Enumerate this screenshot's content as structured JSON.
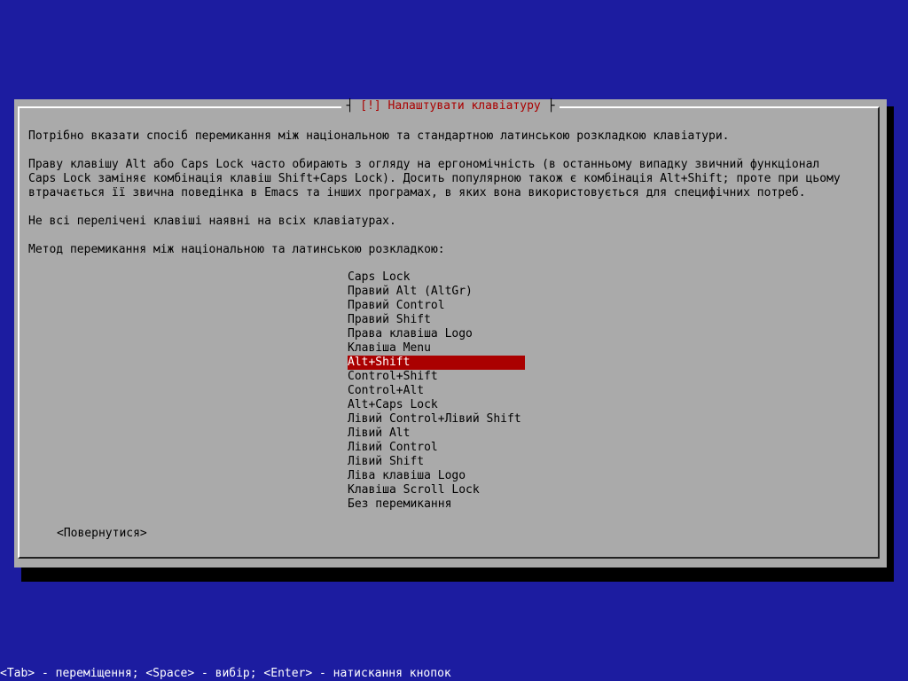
{
  "dialog": {
    "title_bracket_left": "┤ ",
    "title": "[!] Налаштувати клавіатуру",
    "title_bracket_right": " ├",
    "paragraphs": [
      "Потрібно вказати спосіб перемикання між національною та стандартною латинською розкладкою клавіатури.",
      "Праву клавішу Alt або Caps Lock часто обирають з огляду на ергономічність (в останньому випадку звичний функціонал",
      "Caps Lock заміняє комбінація клавіш Shift+Caps Lock). Досить популярною також є комбінація Alt+Shift; проте при цьому",
      "втрачається її звична поведінка в Emacs та інших програмах, в яких вона використовується для специфічних потреб.",
      "Не всі перелічені клавіші наявні на всіх клавіатурах.",
      "Метод перемикання між національною та латинською розкладкою:"
    ],
    "options": [
      "Caps Lock",
      "Правий Alt (AltGr)",
      "Правий Control",
      "Правий Shift",
      "Права клавіша Logo",
      "Клавіша Menu",
      "Alt+Shift",
      "Control+Shift",
      "Control+Alt",
      "Alt+Caps Lock",
      "Лівий Control+Лівий Shift",
      "Лівий Alt",
      "Лівий Control",
      "Лівий Shift",
      "Ліва клавіша Logo",
      "Клавіша Scroll Lock",
      "Без перемикання"
    ],
    "selected_option": "Alt+Shift",
    "back_button": "<Повернутися>"
  },
  "footer": {
    "help": "<Tab> - переміщення; <Space> - вибір; <Enter> - натискання кнопок"
  },
  "colors": {
    "background": "#1c1ca0",
    "dialog": "#aaaaaa",
    "highlight": "#aa0000",
    "title": "#aa0000"
  }
}
